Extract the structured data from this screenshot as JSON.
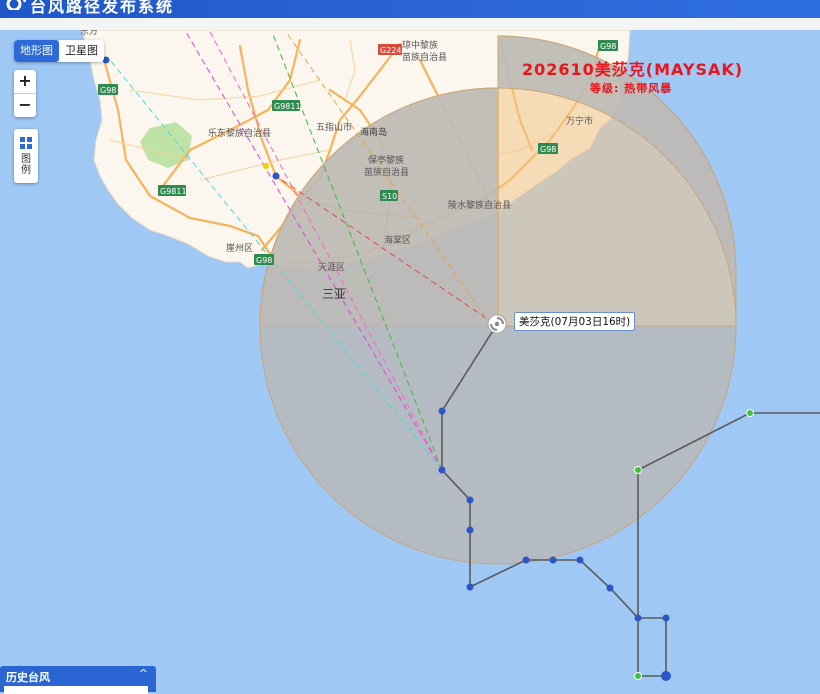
{
  "header": {
    "title": "台风路径发布系统"
  },
  "map_type": {
    "terrain": "地形图",
    "satellite": "卫星图"
  },
  "zoom": {
    "in": "+",
    "out": "−"
  },
  "legend_button": {
    "line1": "图",
    "line2": "例"
  },
  "typhoon": {
    "name_line": "202610美莎克(MAYSAK)",
    "level_line": "等级: 热带风暴",
    "tooltip": "美莎克(07月03日16时)"
  },
  "history_panel": {
    "title": "历史台风",
    "toggle": "^"
  },
  "map_labels": {
    "place_qiongzhong": "琼中黎族",
    "place_qiongzhong2": "苗族自治县",
    "place_ledong": "乐东黎族自治县",
    "place_wuzhishan": "五指山市",
    "place_hainandao": "海南岛",
    "place_baoting": "保亭黎族",
    "place_baoting2": "苗族自治县",
    "place_lingshui": "陵水黎族自治县",
    "place_wanning": "万宁市",
    "place_haitang": "海棠区",
    "place_tianya": "天涯区",
    "place_yazhou": "崖州区",
    "place_sanya": "三亚",
    "place_top": "东方",
    "road_g224": "G224",
    "road_g98_top": "G98",
    "road_g98_left": "G98",
    "road_g98_right": "G98",
    "road_g98_bottom": "G98",
    "road_g9811a": "G9811",
    "road_g9811b": "G9811",
    "road_g9811c": "G9811",
    "road_s10": "S10"
  },
  "colors": {
    "sea": "#9fc8f5",
    "land": "#fbf6ee",
    "wind_circle_fill": "#f3c48a",
    "wind_circle_stroke": "#d99a4c",
    "track_line": "#5a5a5a",
    "point_blue": "#2b56c6",
    "point_green": "#39c23a",
    "title_red": "#e8161c"
  }
}
